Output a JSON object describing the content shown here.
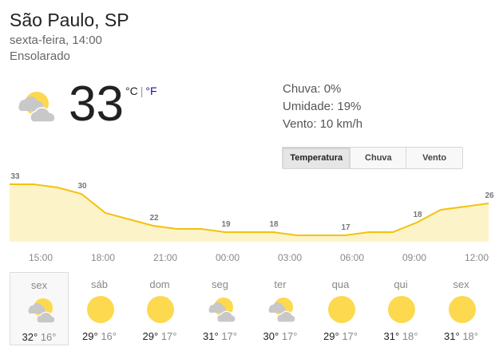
{
  "location": "São Paulo, SP",
  "datetime": "sexta-feira, 14:00",
  "condition": "Ensolarado",
  "current": {
    "temperature": "33",
    "unit_c": "°C",
    "unit_sep": "|",
    "unit_f": "°F",
    "icon": "partly-cloudy-icon"
  },
  "details": {
    "rain": "Chuva: 0%",
    "humidity": "Umidade: 19%",
    "wind": "Vento: 10 km/h"
  },
  "tabs": [
    {
      "label": "Temperatura",
      "active": true
    },
    {
      "label": "Chuva",
      "active": false
    },
    {
      "label": "Vento",
      "active": false
    }
  ],
  "colors": {
    "line": "#f4c20d",
    "fill": "#fdf3c8",
    "sun": "#fcd94e",
    "cloud": "#c8c8c8"
  },
  "chart_data": {
    "type": "area",
    "x_labels": [
      "15:00",
      "18:00",
      "21:00",
      "00:00",
      "03:00",
      "06:00",
      "09:00",
      "12:00"
    ],
    "data_labels": [
      "33",
      "30",
      "22",
      "19",
      "18",
      "17",
      "18",
      "26"
    ],
    "values": [
      33,
      33,
      32,
      30,
      24,
      22,
      20,
      19,
      19,
      18,
      18,
      18,
      17,
      17,
      17,
      18,
      18,
      21,
      25,
      26,
      27
    ],
    "ylim": [
      15,
      36
    ]
  },
  "forecast": [
    {
      "day": "sex",
      "hi": "32°",
      "lo": "16°",
      "icon": "partly-cloudy-icon",
      "selected": true
    },
    {
      "day": "sáb",
      "hi": "29°",
      "lo": "16°",
      "icon": "sun-icon",
      "selected": false
    },
    {
      "day": "dom",
      "hi": "29°",
      "lo": "17°",
      "icon": "sun-icon",
      "selected": false
    },
    {
      "day": "seg",
      "hi": "31°",
      "lo": "17°",
      "icon": "partly-cloudy-icon",
      "selected": false
    },
    {
      "day": "ter",
      "hi": "30°",
      "lo": "17°",
      "icon": "partly-cloudy-icon",
      "selected": false
    },
    {
      "day": "qua",
      "hi": "29°",
      "lo": "17°",
      "icon": "sun-icon",
      "selected": false
    },
    {
      "day": "qui",
      "hi": "31°",
      "lo": "18°",
      "icon": "sun-icon",
      "selected": false
    },
    {
      "day": "sex",
      "hi": "31°",
      "lo": "18°",
      "icon": "sun-icon",
      "selected": false
    }
  ]
}
